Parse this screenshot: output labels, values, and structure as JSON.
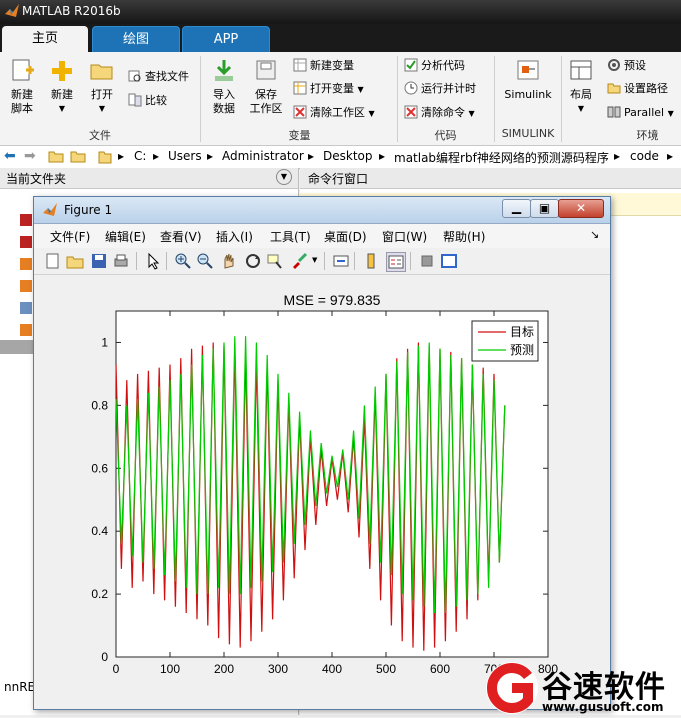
{
  "app": {
    "title": "MATLAB R2016b"
  },
  "tabs": [
    {
      "label": "主页",
      "active": true
    },
    {
      "label": "绘图",
      "active": false
    },
    {
      "label": "APP",
      "active": false
    }
  ],
  "ribbon": {
    "file": {
      "new_script": "新建\n脚本",
      "new": "新建",
      "open": "打开",
      "find_files": "查找文件",
      "compare": "比较",
      "group": "文件"
    },
    "variable": {
      "import": "导入\n数据",
      "save_ws": "保存\n工作区",
      "new_var": "新建变量",
      "open_var": "打开变量",
      "clear_ws": "清除工作区",
      "group": "变量"
    },
    "code": {
      "analyze": "分析代码",
      "run_time": "运行并计时",
      "clear_cmd": "清除命令",
      "group": "代码"
    },
    "simulink": {
      "label": "Simulink",
      "group": "SIMULINK"
    },
    "env": {
      "layout": "布局",
      "prefs": "预设",
      "set_path": "设置路径",
      "parallel": "Parallel",
      "group": "环境"
    }
  },
  "address": {
    "path": [
      "C:",
      "Users",
      "Administrator",
      "Desktop",
      "matlab编程rbf神经网络的预测源码程序",
      "code"
    ]
  },
  "panels": {
    "current_folder": "当前文件夹",
    "command_window": "命令行窗口",
    "bottom_label": "nnRE"
  },
  "figure": {
    "title": "Figure 1",
    "menu": [
      "文件(F)",
      "编辑(E)",
      "查看(V)",
      "插入(I)",
      "工具(T)",
      "桌面(D)",
      "窗口(W)",
      "帮助(H)"
    ]
  },
  "watermark": {
    "brand": "谷速软件",
    "url": "www.gusuoft.com"
  },
  "colors": {
    "accent": "#1e73b7",
    "target": "#d01010",
    "predict": "#00cc00"
  },
  "chart_data": {
    "type": "line",
    "title": "MSE = 979.835",
    "xlim": [
      0,
      800
    ],
    "ylim": [
      0,
      1.1
    ],
    "xticks": [
      0,
      100,
      200,
      300,
      400,
      500,
      600,
      700,
      800
    ],
    "yticks": [
      0,
      0.2,
      0.4,
      0.6,
      0.8,
      1
    ],
    "legend_position": "top-right",
    "series": [
      {
        "name": "目标",
        "color": "#d01010"
      },
      {
        "name": "预测",
        "color": "#00cc00"
      }
    ],
    "x": [
      0,
      10,
      20,
      30,
      40,
      50,
      60,
      70,
      80,
      90,
      100,
      110,
      120,
      130,
      140,
      150,
      160,
      170,
      180,
      190,
      200,
      210,
      220,
      230,
      240,
      250,
      260,
      270,
      280,
      290,
      300,
      310,
      320,
      330,
      340,
      350,
      360,
      370,
      380,
      390,
      400,
      410,
      420,
      430,
      440,
      450,
      460,
      470,
      480,
      490,
      500,
      510,
      520,
      530,
      540,
      550,
      560,
      570,
      580,
      590,
      600,
      610,
      620,
      630,
      640,
      650,
      660,
      670,
      680,
      690,
      700,
      710,
      720
    ],
    "target": [
      0.93,
      0.28,
      0.88,
      0.22,
      0.9,
      0.24,
      0.91,
      0.2,
      0.92,
      0.18,
      0.93,
      0.16,
      0.95,
      0.14,
      0.98,
      0.12,
      0.99,
      0.1,
      1.0,
      0.06,
      0.99,
      0.04,
      0.98,
      0.03,
      0.97,
      0.05,
      0.95,
      0.08,
      0.93,
      0.12,
      0.88,
      0.18,
      0.82,
      0.25,
      0.76,
      0.34,
      0.7,
      0.42,
      0.66,
      0.48,
      0.63,
      0.5,
      0.65,
      0.46,
      0.7,
      0.38,
      0.76,
      0.28,
      0.84,
      0.18,
      0.9,
      0.1,
      0.95,
      0.05,
      0.98,
      0.03,
      1.0,
      0.02,
      0.99,
      0.03,
      0.98,
      0.05,
      0.97,
      0.08,
      0.95,
      0.12,
      0.93,
      0.18,
      0.92,
      0.24,
      0.9,
      0.3,
      0.8
    ],
    "predict": [
      0.82,
      0.36,
      0.8,
      0.32,
      0.82,
      0.3,
      0.84,
      0.28,
      0.86,
      0.26,
      0.88,
      0.24,
      0.9,
      0.22,
      0.93,
      0.2,
      0.96,
      0.2,
      0.98,
      0.22,
      1.0,
      0.2,
      1.02,
      0.2,
      1.02,
      0.22,
      1.0,
      0.24,
      0.96,
      0.27,
      0.9,
      0.3,
      0.84,
      0.36,
      0.78,
      0.42,
      0.72,
      0.48,
      0.68,
      0.52,
      0.64,
      0.54,
      0.66,
      0.5,
      0.72,
      0.44,
      0.8,
      0.36,
      0.86,
      0.3,
      0.9,
      0.26,
      0.94,
      0.2,
      0.97,
      0.18,
      0.99,
      0.16,
      1.0,
      0.14,
      0.98,
      0.14,
      0.96,
      0.16,
      0.95,
      0.18,
      0.93,
      0.2,
      0.9,
      0.22,
      0.88,
      0.3,
      0.8
    ]
  }
}
